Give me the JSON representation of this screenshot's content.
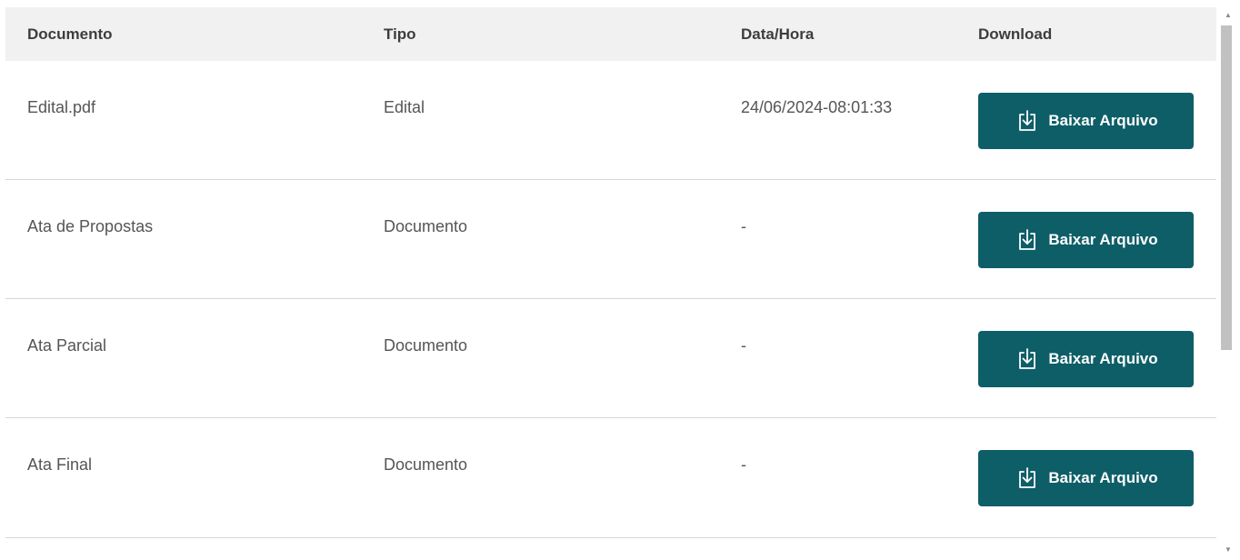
{
  "table": {
    "headers": {
      "documento": "Documento",
      "tipo": "Tipo",
      "data_hora": "Data/Hora",
      "download": "Download"
    },
    "rows": [
      {
        "documento": "Edital.pdf",
        "tipo": "Edital",
        "data_hora": "24/06/2024-08:01:33",
        "button": "Baixar Arquivo"
      },
      {
        "documento": "Ata de Propostas",
        "tipo": "Documento",
        "data_hora": "-",
        "button": "Baixar Arquivo"
      },
      {
        "documento": "Ata Parcial",
        "tipo": "Documento",
        "data_hora": "-",
        "button": "Baixar Arquivo"
      },
      {
        "documento": "Ata Final",
        "tipo": "Documento",
        "data_hora": "-",
        "button": "Baixar Arquivo"
      }
    ]
  },
  "icons": {
    "download": "download-icon",
    "scroll_up": "scroll-up-arrow-icon",
    "scroll_down": "scroll-down-arrow-icon"
  },
  "colors": {
    "button_bg": "#0e5e68",
    "header_bg": "#f1f1f1",
    "row_border": "#d6d6d6"
  }
}
